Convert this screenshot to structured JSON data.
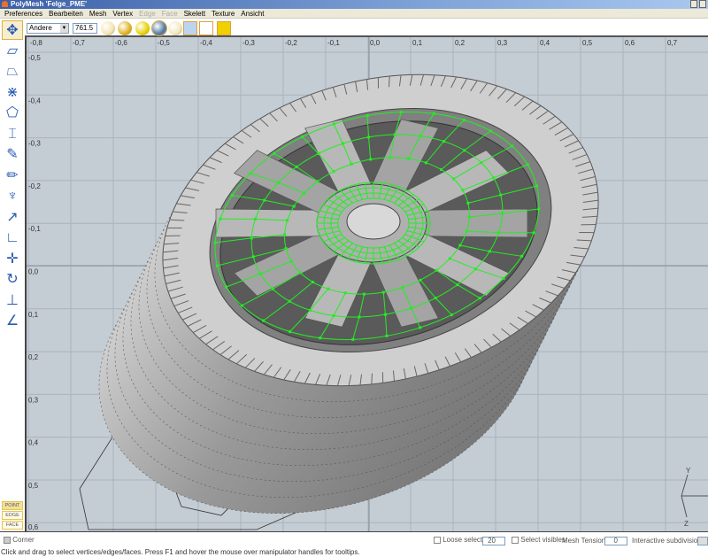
{
  "window": {
    "title": "PolyMesh 'Felge_PME'"
  },
  "menu": [
    {
      "label": "Preferences",
      "enabled": true
    },
    {
      "label": "Bearbeiten",
      "enabled": true
    },
    {
      "label": "Mesh",
      "enabled": true
    },
    {
      "label": "Vertex",
      "enabled": true
    },
    {
      "label": "Edge",
      "enabled": false
    },
    {
      "label": "Face",
      "enabled": false
    },
    {
      "label": "Skelett",
      "enabled": true
    },
    {
      "label": "Texture",
      "enabled": true
    },
    {
      "label": "Ansicht",
      "enabled": true
    }
  ],
  "toolbar": {
    "view_select": "Andere",
    "scale_value": "761.5",
    "icons": [
      "wireframe-sphere-icon",
      "shaded-sphere-icon",
      "smooth-sphere-icon",
      "textured-sphere-icon",
      "transparent-sphere-icon",
      "grid-icon",
      "axes-icon",
      "lights-icon"
    ]
  },
  "tools": [
    "move-tool-icon",
    "skew-tool-icon",
    "taper-tool-icon",
    "bevel-tool-icon",
    "extrude-tool-icon",
    "thicken-tool-icon",
    "knife-tool-icon",
    "brush-tool-icon",
    "claw-tool-icon",
    "pin-tool-icon",
    "skeleton-tool-icon",
    "move-view-icon",
    "rotate-view-icon",
    "measure-icon",
    "angle-icon"
  ],
  "modes": [
    "POINT",
    "EDGE",
    "FACE"
  ],
  "ruler": {
    "x": [
      "-0,8",
      "-0,7",
      "-0,6",
      "-0,5",
      "-0,4",
      "-0,3",
      "-0,2",
      "-0,1",
      "0,0",
      "0,1",
      "0,2",
      "0,3",
      "0,4",
      "0,5",
      "0,6",
      "0,7"
    ],
    "y": [
      "-0,5",
      "-0,4",
      "-0,3",
      "-0,2",
      "-0,1",
      "0,0",
      "0,1",
      "0,2",
      "0,3",
      "0,4",
      "0,5",
      "0,6"
    ]
  },
  "axes": {
    "y": "Y",
    "z": "Z"
  },
  "status": {
    "corner_label": "Corner",
    "loose_select_label": "Loose select",
    "loose_select_value": "20",
    "select_visibles_label": "Select visibles",
    "mesh_tension_label": "Mesh Tension:",
    "mesh_tension_value": "0",
    "interactive_subdiv_label": "Interactive subdivisions",
    "hint": "Click and drag to select vertices/edges/faces. Press F1 and hover the mouse over manipulator handles for tooltips."
  },
  "colors": {
    "mesh": "#22ee22",
    "viewport": "#c4ccd4"
  }
}
